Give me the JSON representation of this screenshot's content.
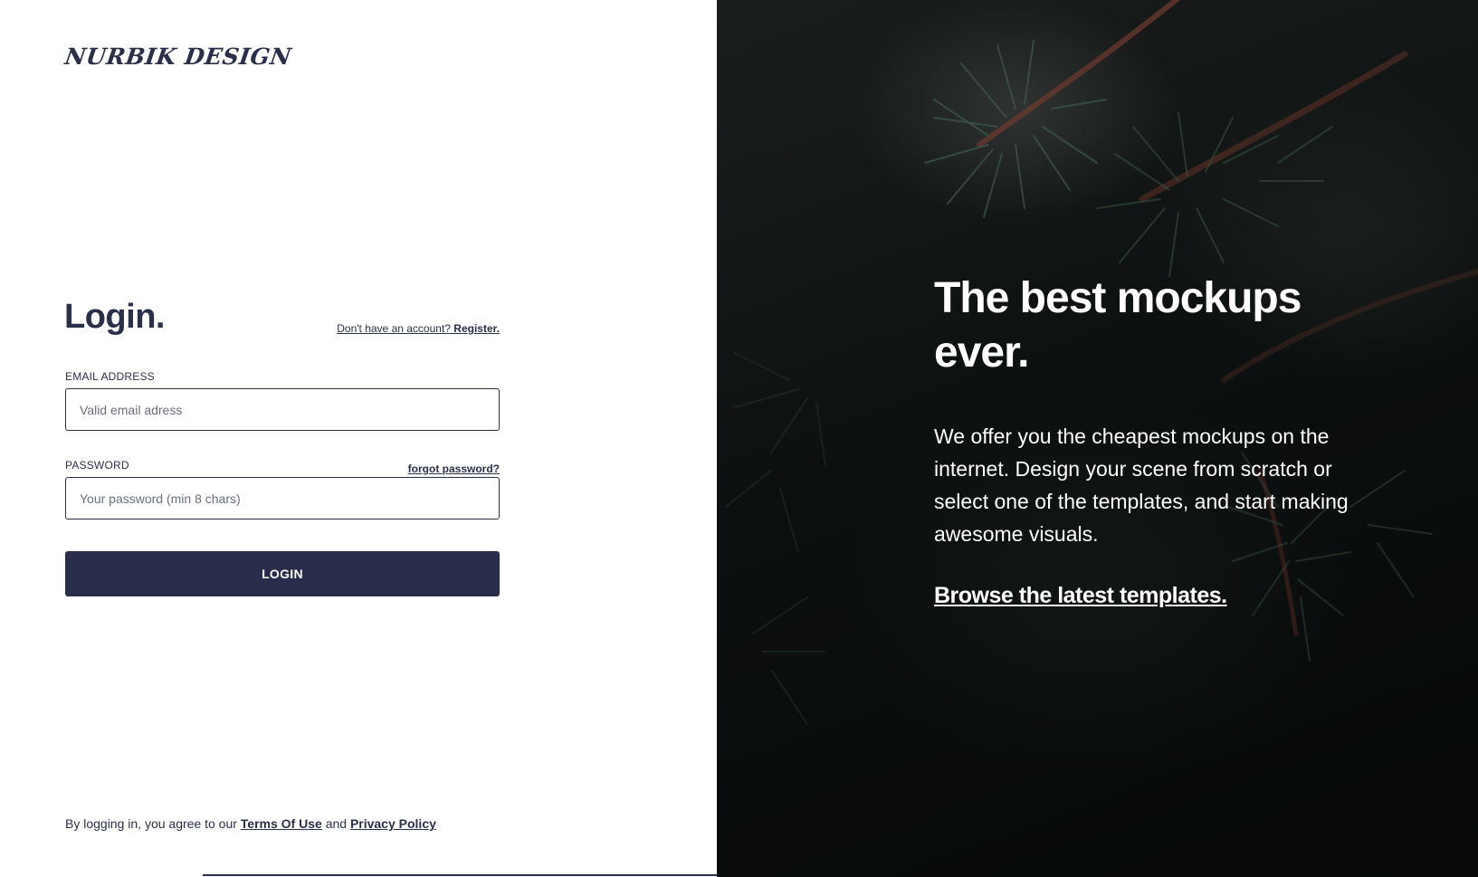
{
  "brand": {
    "logo_text": "NURBIK DESIGN"
  },
  "login": {
    "title": "Login.",
    "register_prompt": "Don't have an account?",
    "register_link": "Register.",
    "email_label": "EMAIL ADDRESS",
    "email_placeholder": "Valid email adress",
    "email_value": "",
    "password_label": "PASSWORD",
    "forgot_label": "forgot password?",
    "password_placeholder": "Your password (min 8 chars)",
    "password_value": "",
    "button_label": "LOGIN"
  },
  "footer": {
    "prefix": "By logging in, you agree to our",
    "terms_link": "Terms Of Use",
    "and": "and",
    "privacy_link": "Privacy Policy"
  },
  "hero": {
    "title": "The best mockups ever.",
    "body": "We offer you the cheapest mockups on the internet. Design your scene from scratch or select one of the templates, and start making awesome visuals.",
    "link": "Browse the latest templates."
  },
  "colors": {
    "primary": "#272d4a",
    "text": "#2a2f4a",
    "hero_bg": "#0d1010",
    "white": "#ffffff"
  },
  "icons": {
    "background_image": "pine-branches-photo"
  }
}
